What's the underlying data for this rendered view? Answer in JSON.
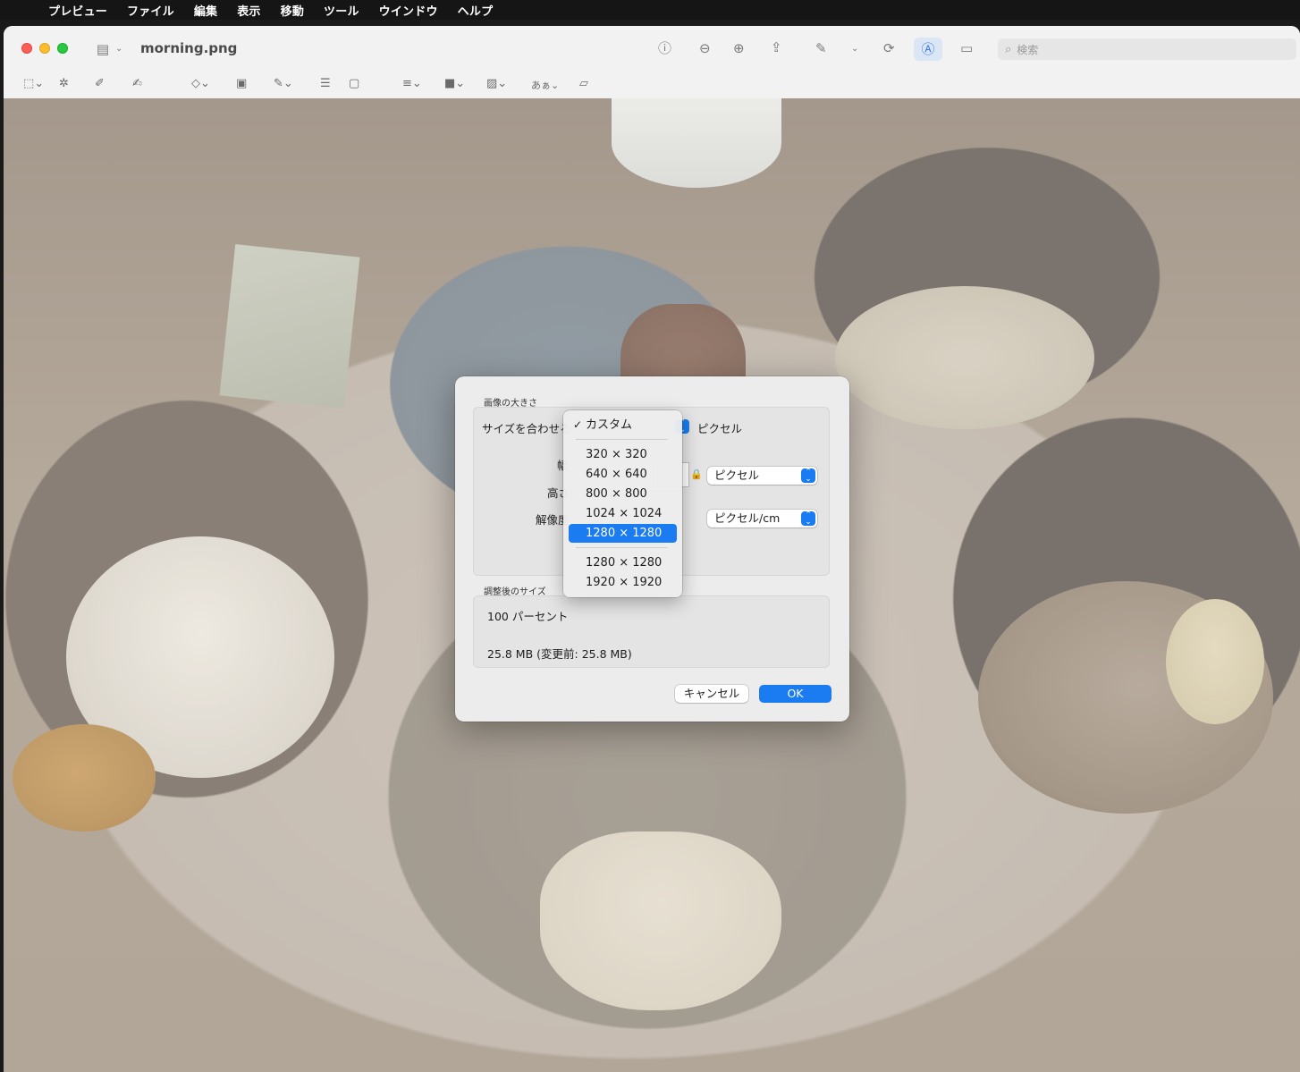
{
  "menubar": {
    "app": "プレビュー",
    "items": [
      "ファイル",
      "編集",
      "表示",
      "移動",
      "ツール",
      "ウインドウ",
      "ヘルプ"
    ]
  },
  "window": {
    "title": "morning.png",
    "search_placeholder": "検索"
  },
  "dialog": {
    "image_size_section": "画像の大きさ",
    "fit_label": "サイズを合わせる",
    "fit_unit": "ピクセル",
    "width_label": "幅",
    "height_label": "高さ",
    "resolution_label": "解像度",
    "unit_popup": "ピクセル",
    "resolution_unit_popup": "ピクセル/cm",
    "result_section": "調整後のサイズ",
    "percent": "100 パーセント",
    "filesize": "25.8 MB (変更前: 25.8 MB)",
    "cancel": "キャンセル",
    "ok": "OK"
  },
  "size_menu": {
    "checked": "カスタム",
    "group1": [
      "320 × 320",
      "640 × 640",
      "800 × 800",
      "1024 × 1024",
      "1280 × 1280"
    ],
    "highlighted_index": 4,
    "group2": [
      "1280 × 1280",
      "1920 × 1920"
    ]
  },
  "icons": {
    "apple": "apple-logo-icon",
    "sidebar": "sidebar-icon",
    "info": "info-icon",
    "zoom_out": "zoom-out-icon",
    "zoom_in": "zoom-in-icon",
    "share": "share-icon",
    "highlight": "highlight-pen-icon",
    "rotate": "rotate-icon",
    "markup": "markup-icon",
    "form": "form-fill-icon",
    "search": "magnifier-icon"
  },
  "colors": {
    "accent": "#1a7cf0",
    "close": "#ff5f57",
    "minimize": "#febc2e",
    "maximize": "#28c840"
  }
}
